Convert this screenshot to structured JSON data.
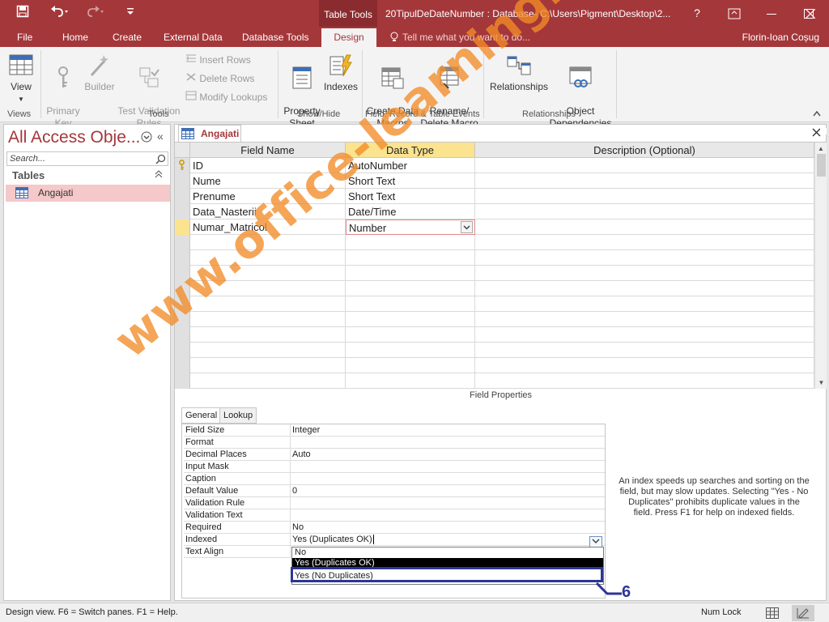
{
  "titlebar": {
    "context_tab": "Table Tools",
    "document_title": "20TipulDeDateNumber : Database- C:\\Users\\Pigment\\Desktop\\2...",
    "help": "?"
  },
  "ribbon_tabs": {
    "file": "File",
    "home": "Home",
    "create": "Create",
    "external_data": "External Data",
    "database_tools": "Database Tools",
    "design": "Design",
    "tell_me": "Tell me what you want to do...",
    "user": "Florin-Ioan Coșug"
  },
  "ribbon": {
    "view": "View",
    "primary_key": "Primary\nKey",
    "builder": "Builder",
    "test_validation": "Test Validation\nRules",
    "insert_rows": "Insert Rows",
    "delete_rows": "Delete Rows",
    "modify_lookups": "Modify Lookups",
    "property_sheet": "Property\nSheet",
    "indexes": "Indexes",
    "create_data_macros": "Create Data\nMacros",
    "rename_delete_macro": "Rename/\nDelete Macro",
    "relationships": "Relationships",
    "object_dependencies": "Object\nDependencies",
    "groups": {
      "views": "Views",
      "tools": "Tools",
      "show_hide": "Show/Hide",
      "field_record_events": "Field, Record & Table Events",
      "relationships": "Relationships"
    }
  },
  "nav": {
    "title": "All Access Obje...",
    "search_placeholder": "Search...",
    "section": "Tables",
    "items": [
      "Angajati"
    ]
  },
  "document": {
    "tab_label": "Angajati",
    "columns": [
      "Field Name",
      "Data Type",
      "Description (Optional)"
    ],
    "rows": [
      {
        "name": "ID",
        "type": "AutoNumber",
        "desc": ""
      },
      {
        "name": "Nume",
        "type": "Short Text",
        "desc": ""
      },
      {
        "name": "Prenume",
        "type": "Short Text",
        "desc": ""
      },
      {
        "name": "Data_Nasterii",
        "type": "Date/Time",
        "desc": ""
      },
      {
        "name": "Numar_Matricol",
        "type": "Number",
        "desc": ""
      }
    ],
    "field_properties_label": "Field Properties",
    "prop_tabs": [
      "General",
      "Lookup"
    ],
    "properties": [
      {
        "name": "Field Size",
        "value": "Integer"
      },
      {
        "name": "Format",
        "value": ""
      },
      {
        "name": "Decimal Places",
        "value": "Auto"
      },
      {
        "name": "Input Mask",
        "value": ""
      },
      {
        "name": "Caption",
        "value": ""
      },
      {
        "name": "Default Value",
        "value": "0"
      },
      {
        "name": "Validation Rule",
        "value": ""
      },
      {
        "name": "Validation Text",
        "value": ""
      },
      {
        "name": "Required",
        "value": "No"
      },
      {
        "name": "Indexed",
        "value": "Yes (Duplicates OK)"
      },
      {
        "name": "Text Align",
        "value": ""
      }
    ],
    "indexed_options": [
      "No",
      "Yes (Duplicates OK)",
      "Yes (No Duplicates)"
    ],
    "help_text": "An index speeds up searches and sorting on the field, but may slow updates. Selecting \"Yes - No Duplicates\" prohibits duplicate values in the field. Press F1 for help on indexed fields.",
    "callout_number": "6",
    "watermark": "www.office-learning.ro"
  },
  "statusbar": {
    "text": "Design view.  F6 = Switch panes.  F1 = Help.",
    "num_lock": "Num Lock"
  },
  "colors": {
    "accent": "#a4373a",
    "active_header": "#fbe38f",
    "callout": "#2e3596",
    "watermark": "#f28c28"
  }
}
